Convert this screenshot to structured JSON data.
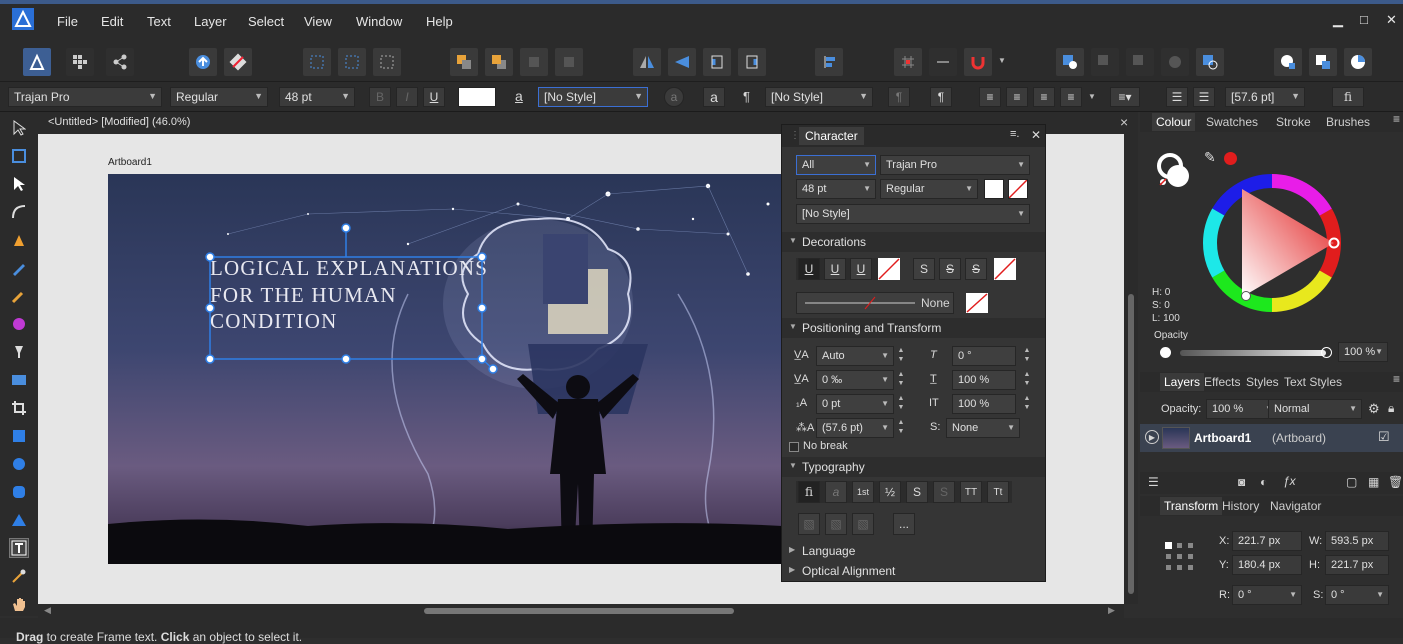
{
  "menu": {
    "items": [
      "File",
      "Edit",
      "Text",
      "Layer",
      "Select",
      "View",
      "Window",
      "Help"
    ]
  },
  "context": {
    "font": "Trajan Pro",
    "weight": "Regular",
    "size": "48 pt",
    "para_style": "[No Style]",
    "char_style": "[No Style]",
    "leading": "[57.6 pt]",
    "b": "B",
    "i": "I",
    "u": "U",
    "a": "a",
    "pilcrow": "¶",
    "fi": "fi"
  },
  "document": {
    "tab_title": "<Untitled> [Modified] (46.0%)",
    "artboard_label": "Artboard1",
    "close": "×"
  },
  "artboard_text": {
    "line1": "LOGICAL EXPLANATIONS",
    "line2": "FOR THE HUMAN",
    "line3": "CONDITION"
  },
  "character": {
    "title": "Character",
    "scope": "All",
    "font": "Trajan Pro",
    "size": "48 pt",
    "weight": "Regular",
    "style": "[No Style]",
    "decorations": "Decorations",
    "line_none": "None",
    "deco_u": "U",
    "deco_s": "S",
    "positioning": "Positioning and Transform",
    "kerning": "Auto",
    "tracking": "0 ‰",
    "baseline": "0 pt",
    "leading": "(57.6 pt)",
    "shear": "0 °",
    "hscale": "100 %",
    "vscale": "100 %",
    "case": "None",
    "none_label": "S:",
    "no_break": "No break",
    "typography": "Typography",
    "typo": {
      "fi": "fi",
      "a": "a",
      "st": "1st",
      "half": "½",
      "s": "S",
      "tt": "TT",
      "t2": "Tt",
      "more": "..."
    },
    "language": "Language",
    "optical": "Optical Alignment"
  },
  "colour": {
    "tabs": [
      "Colour",
      "Swatches",
      "Stroke",
      "Brushes"
    ],
    "h": "H: 0",
    "s": "S: 0",
    "l": "L: 100",
    "opacity_label": "Opacity",
    "opacity": "100 %"
  },
  "layers": {
    "tabs": [
      "Layers",
      "Effects",
      "Styles",
      "Text Styles"
    ],
    "opacity_label": "Opacity:",
    "opacity": "100 %",
    "blend": "Normal",
    "layer_name": "Artboard1",
    "layer_type": "(Artboard)"
  },
  "transform": {
    "tabs": [
      "Transform",
      "History",
      "Navigator"
    ],
    "x_label": "X:",
    "x": "221.7 px",
    "y_label": "Y:",
    "y": "180.4 px",
    "w_label": "W:",
    "w": "593.5 px",
    "h_label": "H:",
    "h": "221.7 px",
    "r_label": "R:",
    "r": "0 °",
    "s_label": "S:",
    "s": "0 °"
  },
  "status": {
    "drag": "Drag",
    "text1": " to create Frame text. ",
    "click": "Click",
    "text2": " an object to select it."
  },
  "colors": {
    "accent": "#3b6fd4",
    "selection": "#2f7fe6",
    "red": "#e11d1d"
  }
}
